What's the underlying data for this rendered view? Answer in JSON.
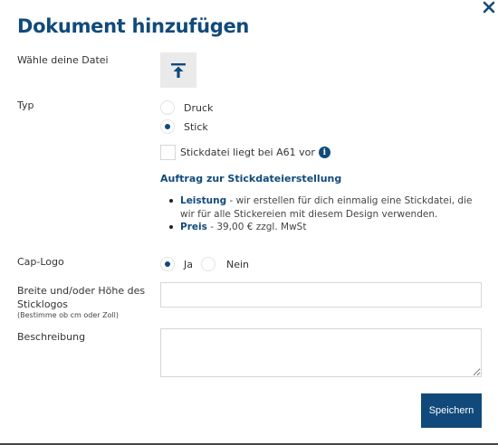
{
  "dialog": {
    "title": "Dokument hinzufügen",
    "close_icon": "close-icon"
  },
  "file": {
    "label": "Wähle deine Datei",
    "upload_icon": "upload-icon"
  },
  "type": {
    "label": "Typ",
    "options": [
      {
        "label": "Druck",
        "checked": false
      },
      {
        "label": "Stick",
        "checked": true
      }
    ]
  },
  "stick_file": {
    "label": "Stickdatei liegt bei A61 vor",
    "checked": false,
    "info_glyph": "i",
    "info_icon": "info-icon"
  },
  "order": {
    "title": "Auftrag zur Stickdateierstellung",
    "items": [
      {
        "term": "Leistung",
        "text": " - wir erstellen für dich einmalig eine Stickdatei, die wir für alle Stickereien mit diesem Design verwenden."
      },
      {
        "term": "Preis",
        "text": " - 39,00 € zzgl. MwSt"
      }
    ]
  },
  "cap_logo": {
    "label": "Cap-Logo",
    "options": [
      {
        "label": "Ja",
        "checked": true
      },
      {
        "label": "Nein",
        "checked": false
      }
    ]
  },
  "size": {
    "label": "Breite und/oder Höhe des Sticklogos",
    "hint": "(Bestimme ob cm oder Zoll)",
    "value": "",
    "placeholder": ""
  },
  "description": {
    "label": "Beschreibung",
    "value": "",
    "placeholder": ""
  },
  "actions": {
    "save_label": "Speichern"
  },
  "colors": {
    "brand": "#114a7a",
    "upload_bg": "#eaeaea",
    "border": "#d6d6d6"
  }
}
